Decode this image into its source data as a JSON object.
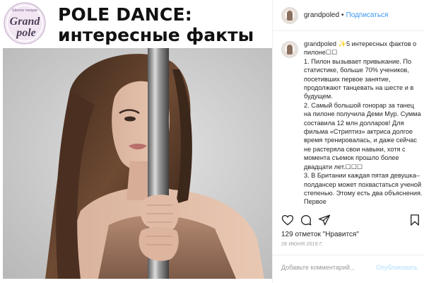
{
  "image": {
    "logo": {
      "text_top": "Школа танцев",
      "text_main_1": "Grand",
      "text_main_2": "pole"
    },
    "headline_line1": "POLE DANCE:",
    "headline_line2": "интересные факты"
  },
  "panel": {
    "username": "grandpoled",
    "separator": "•",
    "follow_label": "Подписаться",
    "caption_user": "grandpoled",
    "caption_lines": [
      "✨5 интересных фактов о пилоне☐☐",
      "1. Пилон вызывает привыкание. По статистике, больше 70% учеников, посетивших первое занятие, продолжают танцевать на шесте и в будущем.",
      "2. Самый большой гонорар за танец на пилоне получила Деми Мур. Сумма составила 12 млн долларов! Для фильма «Стриптиз» актриса долгое время тренировалась, и даже сейчас не растеряла свои навыки, хотя с момента съемок прошло более двадцати лет.☐☐☐",
      "3. В Британии каждая пятая девушка–полдансер может похвастаться ученой степенью. Этому есть два объяснения. Первое"
    ],
    "likes": "129 отметок \"Нравится\"",
    "date": "28 ИЮНЯ 2019 Г.",
    "comment_placeholder": "Добавьте комментарий...",
    "publish_label": "Опубликовать"
  },
  "colors": {
    "link_blue": "#3897f0",
    "publish_disabled": "#b2dffc",
    "border": "#efefef"
  },
  "icons": [
    "heart-icon",
    "comment-icon",
    "share-icon",
    "bookmark-icon"
  ]
}
